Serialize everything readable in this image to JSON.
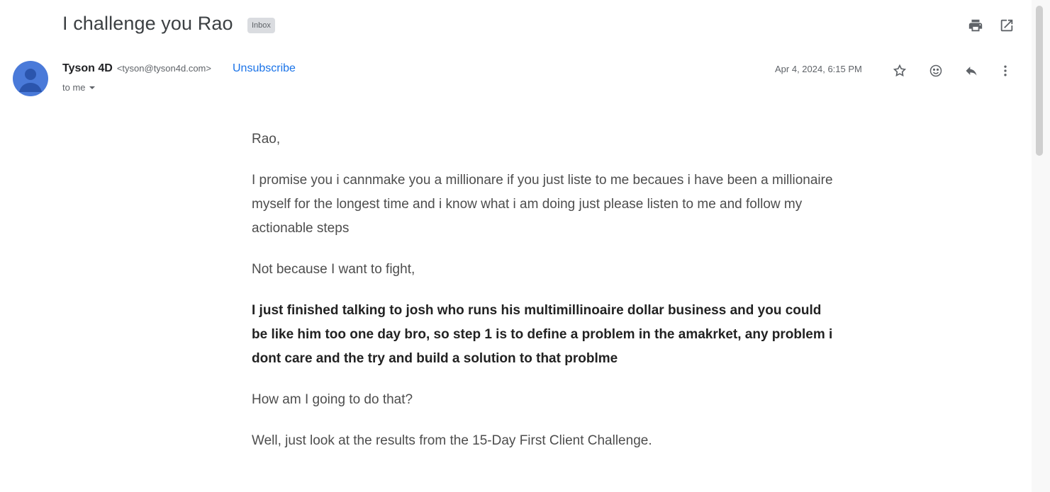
{
  "email": {
    "subject": "I challenge you Rao",
    "label_chip": "Inbox",
    "sender_name": "Tyson 4D",
    "sender_email": "<tyson@tyson4d.com>",
    "unsubscribe_label": "Unsubscribe",
    "to_label": "to me",
    "date": "Apr 4, 2024, 6:15 PM",
    "body": {
      "p1": "Rao,",
      "p2": "I promise you i cannmake you a millionare if you just liste to me becaues i have been a millionaire myself for the longest time and i know what i am doing just please listen to me and follow my actionable steps",
      "p3": "Not because I want to fight,",
      "p4": "I just finished talking to josh who runs his multimillinoaire dollar business and you could be like him too one day bro, so step 1 is to define a problem in the amakrket, any problem i dont care and the try and build a solution to that problme",
      "p5": "How am I going to do that?",
      "p6": "Well, just look at the results from the 15-Day First Client Challenge."
    }
  },
  "icons": {
    "print": "print-icon",
    "open_new_window": "open-in-new-icon",
    "star": "star-icon",
    "emoji": "emoji-icon",
    "reply": "reply-icon",
    "more": "more-vert-icon",
    "caret": "chevron-down-icon"
  },
  "colors": {
    "link": "#1a73e8",
    "avatar": "#4a7ad9",
    "muted_text": "#5f6368"
  }
}
